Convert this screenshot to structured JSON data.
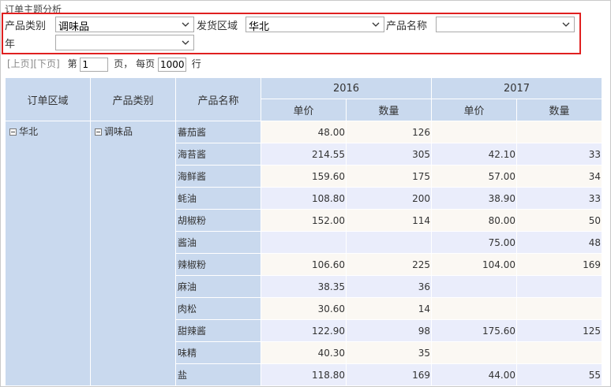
{
  "title": "订单主题分析",
  "filters": {
    "category_label": "产品类别",
    "category_value": "调味品",
    "region_label": "发货区域",
    "region_value": "华北",
    "product_label": "产品名称",
    "product_value": "",
    "year_label": "年",
    "year_value": ""
  },
  "pager": {
    "prev": "[上页]",
    "next": "[下页]",
    "page_prefix": "第",
    "page_value": "1",
    "page_suffix": "页，",
    "per_page_prefix": "每页",
    "per_page_value": "1000",
    "per_page_suffix": "行"
  },
  "table": {
    "col_region": "订单区域",
    "col_category": "产品类别",
    "col_product": "产品名称",
    "years": [
      "2016",
      "2017"
    ],
    "measures": [
      "单价",
      "数量"
    ],
    "region": "华北",
    "category": "调味品",
    "rows": [
      {
        "name": "蕃茄酱",
        "p16": "48.00",
        "q16": "126",
        "p17": "",
        "q17": ""
      },
      {
        "name": "海苔酱",
        "p16": "214.55",
        "q16": "305",
        "p17": "42.10",
        "q17": "33"
      },
      {
        "name": "海鲜酱",
        "p16": "159.60",
        "q16": "175",
        "p17": "57.00",
        "q17": "34"
      },
      {
        "name": "蚝油",
        "p16": "108.80",
        "q16": "200",
        "p17": "38.90",
        "q17": "33"
      },
      {
        "name": "胡椒粉",
        "p16": "152.00",
        "q16": "114",
        "p17": "80.00",
        "q17": "50"
      },
      {
        "name": "酱油",
        "p16": "",
        "q16": "",
        "p17": "75.00",
        "q17": "48"
      },
      {
        "name": "辣椒粉",
        "p16": "106.60",
        "q16": "225",
        "p17": "104.00",
        "q17": "169"
      },
      {
        "name": "麻油",
        "p16": "38.35",
        "q16": "36",
        "p17": "",
        "q17": ""
      },
      {
        "name": "肉松",
        "p16": "30.60",
        "q16": "14",
        "p17": "",
        "q17": ""
      },
      {
        "name": "甜辣酱",
        "p16": "122.90",
        "q16": "98",
        "p17": "175.60",
        "q17": "125"
      },
      {
        "name": "味精",
        "p16": "40.30",
        "q16": "35",
        "p17": "",
        "q17": ""
      },
      {
        "name": "盐",
        "p16": "118.80",
        "q16": "169",
        "p17": "44.00",
        "q17": "55"
      }
    ]
  }
}
